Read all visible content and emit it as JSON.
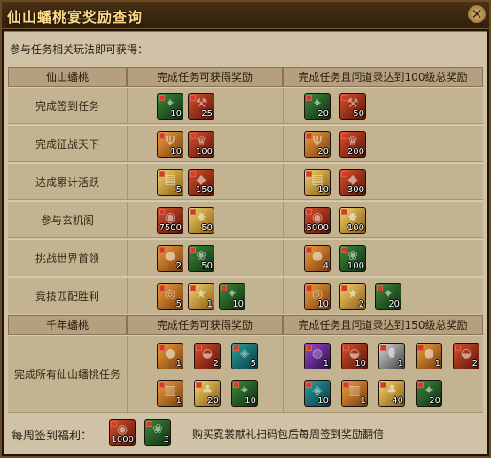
{
  "window": {
    "title": "仙山蟠桃宴奖励查询",
    "close_glyph": "✕"
  },
  "intro": "参与任务相关玩法即可获得：",
  "section1": {
    "headers": [
      "仙山蟠桃",
      "完成任务可获得奖励",
      "完成任务且问道录达到100级总奖励"
    ],
    "rows": [
      {
        "label": "完成签到任务",
        "a": [
          {
            "icon": "fish-icon",
            "color": "c-green",
            "count": "10"
          },
          {
            "icon": "hammer-icon",
            "color": "c-red",
            "count": "25"
          }
        ],
        "b": [
          {
            "icon": "fish-icon",
            "color": "c-green",
            "count": "20"
          },
          {
            "icon": "hammer-icon",
            "color": "c-red",
            "count": "50"
          }
        ]
      },
      {
        "label": "完成征战天下",
        "a": [
          {
            "icon": "trident-icon",
            "color": "c-orange",
            "count": "10"
          },
          {
            "icon": "crown-icon",
            "color": "c-red",
            "count": "100"
          }
        ],
        "b": [
          {
            "icon": "trident-icon",
            "color": "c-orange",
            "count": "20"
          },
          {
            "icon": "crown-icon",
            "color": "c-red",
            "count": "200"
          }
        ]
      },
      {
        "label": "达成累计活跃",
        "a": [
          {
            "icon": "scroll-icon",
            "color": "c-gold",
            "count": "5"
          },
          {
            "icon": "gem-icon",
            "color": "c-red",
            "count": "150"
          }
        ],
        "b": [
          {
            "icon": "scroll-icon",
            "color": "c-gold",
            "count": "10"
          },
          {
            "icon": "gem-icon",
            "color": "c-red",
            "count": "300"
          }
        ]
      },
      {
        "label": "参与玄机阁",
        "a": [
          {
            "icon": "drum-icon",
            "color": "c-red",
            "count": "7500"
          },
          {
            "icon": "burst-icon",
            "color": "c-gold",
            "count": "50"
          }
        ],
        "b": [
          {
            "icon": "drum-icon",
            "color": "c-red",
            "count": "15000"
          },
          {
            "icon": "burst-icon",
            "color": "c-gold",
            "count": "100"
          }
        ]
      },
      {
        "label": "挑战世界首领",
        "a": [
          {
            "icon": "pouch-icon",
            "color": "c-orange",
            "count": "2"
          },
          {
            "icon": "flower-icon",
            "color": "c-green",
            "count": "50"
          }
        ],
        "b": [
          {
            "icon": "pouch-icon",
            "color": "c-orange",
            "count": "4"
          },
          {
            "icon": "flower-icon",
            "color": "c-green",
            "count": "100"
          }
        ]
      },
      {
        "label": "竞技匹配胜利",
        "a": [
          {
            "icon": "coin-icon",
            "color": "c-orange",
            "count": "5"
          },
          {
            "icon": "star-icon",
            "color": "c-gold",
            "count": "1"
          },
          {
            "icon": "fish-icon",
            "color": "c-green",
            "count": "10"
          }
        ],
        "b": [
          {
            "icon": "coin-icon",
            "color": "c-orange",
            "count": "10"
          },
          {
            "icon": "star-icon",
            "color": "c-gold",
            "count": "2"
          },
          {
            "icon": "fish-icon",
            "color": "c-green",
            "count": "20"
          }
        ]
      }
    ]
  },
  "section2": {
    "headers": [
      "千年蟠桃",
      "完成任务可获得奖励",
      "完成任务且问道录达到150级总奖励"
    ],
    "row": {
      "label": "完成所有仙山蟠桃任务",
      "a": [
        {
          "icon": "pouch-icon",
          "color": "c-orange",
          "count": "1"
        },
        {
          "icon": "bag-icon",
          "color": "c-red",
          "count": "2"
        },
        {
          "icon": "crystal-icon",
          "color": "c-teal",
          "count": "5"
        },
        {
          "icon": "book-icon",
          "color": "c-orange",
          "count": "1"
        },
        {
          "icon": "gourd-icon",
          "color": "c-gold",
          "count": "20"
        },
        {
          "icon": "fish-icon",
          "color": "c-green",
          "count": "10"
        }
      ],
      "b": [
        {
          "icon": "orb-icon",
          "color": "c-purple",
          "count": "1"
        },
        {
          "icon": "bag-icon",
          "color": "c-red",
          "count": "10"
        },
        {
          "icon": "egg-icon",
          "color": "c-silver",
          "count": "1"
        },
        {
          "icon": "pouch-icon",
          "color": "c-orange",
          "count": "1"
        },
        {
          "icon": "bag-icon",
          "color": "c-red",
          "count": "2"
        },
        {
          "icon": "crystal-icon",
          "color": "c-teal",
          "count": "10"
        },
        {
          "icon": "book-icon",
          "color": "c-orange",
          "count": "1"
        },
        {
          "icon": "gourd-icon",
          "color": "c-gold",
          "count": "40"
        },
        {
          "icon": "fish-icon",
          "color": "c-green",
          "count": "20"
        }
      ]
    }
  },
  "footer": {
    "label": "每周签到福利：",
    "items": [
      {
        "icon": "drum-icon",
        "color": "c-red",
        "count": "1000"
      },
      {
        "icon": "flower-icon",
        "color": "c-green",
        "count": "3"
      }
    ],
    "note": "购买霓裳献礼扫码包后每周签到奖励翻倍"
  }
}
